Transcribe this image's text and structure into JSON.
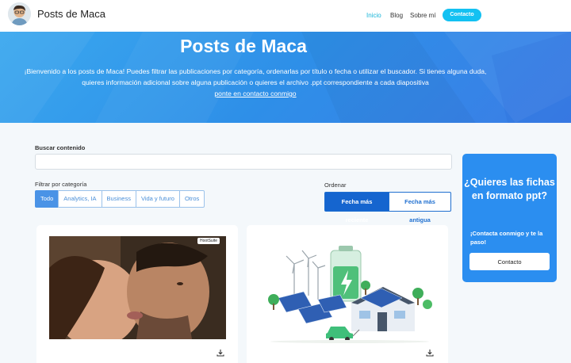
{
  "navbar": {
    "brand": "Posts de Maca",
    "links": [
      "Inicio",
      "Blog",
      "Sobre mí"
    ],
    "active_link": "Inicio",
    "contact_button": "Contacto",
    "accent_color": "#13c1f2"
  },
  "hero": {
    "title": "Posts de Maca",
    "text": "¡Bienvenido a los posts de Maca! Puedes filtrar las publicaciones por categoría, ordenarlas por título o fecha o utilizar el buscador. Si tienes alguna duda, quieres información adicional sobre alguna publicación o quieres el archivo .ppt correspondiente a cada diapositiva",
    "link_text": "ponte en contacto conmigo",
    "background_color": "#3b9aee"
  },
  "search": {
    "label": "Buscar contenido",
    "value": "",
    "placeholder": ""
  },
  "filters": {
    "label": "Filtrar por categoría",
    "categories": [
      "Todo",
      "Analytics, IA",
      "Business",
      "Vida y futuro",
      "Otros"
    ],
    "selected": "Todo"
  },
  "sort": {
    "label": "Ordenar",
    "options": [
      "Fecha más reciente",
      "Fecha más antigua"
    ],
    "selected": "Fecha más reciente"
  },
  "sidebar": {
    "title": "¿Quieres las fichas en formato ppt?",
    "subtitle": "¡Contacta conmigo y te la paso!",
    "button": "Contacto",
    "background_color": "#2b8ef0"
  },
  "posts": [
    {
      "image": "couple-photo",
      "watermark": "HootSuite",
      "icon": "download-icon"
    },
    {
      "image": "renewable-energy-illustration",
      "icon": "download-icon"
    }
  ]
}
